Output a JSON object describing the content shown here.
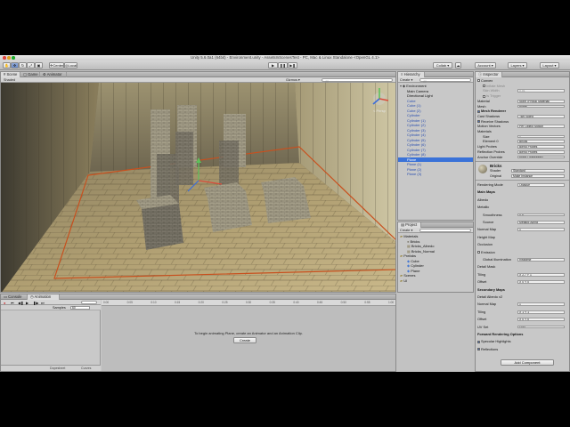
{
  "window": {
    "title": "Unity 5.6.0a1 (64bit) - Environment.unity - AssetsInScenesTest - PC, Mac & Linux Standalone <OpenGL 4.1>"
  },
  "toolbar": {
    "pivot_label": "Center",
    "space_label": "Local",
    "collab_label": "Collab ▾",
    "account_label": "Account ▾",
    "layers_label": "Layers ▾",
    "layout_label": "Layout ▾"
  },
  "scene": {
    "tabs": [
      "Scene",
      "Game",
      "Animator"
    ],
    "shading_mode": "Shaded",
    "gizmos_label": "Gizmos ▾",
    "search_placeholder": "All",
    "persp_label": "< Persp"
  },
  "hierarchy": {
    "tab": "Hierarchy",
    "create_label": "Create ▾",
    "search_placeholder": "All",
    "root": "Environment",
    "items": [
      "Main Camera",
      "Directional Light",
      "Cube",
      "Cube (1)",
      "Cube (2)",
      "Cylinder",
      "Cylinder (1)",
      "Cylinder (2)",
      "Cylinder (3)",
      "Cylinder (4)",
      "Cylinder (5)",
      "Cylinder (6)",
      "Cylinder (7)",
      "Cylinder (8)",
      "Plane",
      "Plane (1)",
      "Plane (2)",
      "Plane (3)"
    ],
    "selected": "Plane"
  },
  "project": {
    "tab": "Project",
    "create_label": "Create ▾",
    "items": [
      {
        "label": "Materials",
        "depth": 0,
        "type": "folder"
      },
      {
        "label": "Bricks",
        "depth": 1,
        "type": "material"
      },
      {
        "label": "Bricks_Albedo",
        "depth": 1,
        "type": "texture"
      },
      {
        "label": "Bricks_Normal",
        "depth": 1,
        "type": "texture"
      },
      {
        "label": "Prefabs",
        "depth": 0,
        "type": "folder"
      },
      {
        "label": "Cube",
        "depth": 1,
        "type": "prefab"
      },
      {
        "label": "Cylinder",
        "depth": 1,
        "type": "prefab"
      },
      {
        "label": "Plane",
        "depth": 1,
        "type": "prefab"
      },
      {
        "label": "Scenes",
        "depth": 0,
        "type": "folder"
      },
      {
        "label": "UI",
        "depth": 0,
        "type": "folder"
      }
    ]
  },
  "animation": {
    "tabs": [
      "Console",
      "Animation"
    ],
    "samples_label": "Samples",
    "samples_value": "60",
    "timeline_ticks": [
      "0:00",
      "0:05",
      "0:10",
      "0:15",
      "0:20",
      "0:25",
      "0:30",
      "0:35",
      "0:40",
      "0:45",
      "0:50",
      "0:55",
      "1:00"
    ],
    "message": "To begin animating Plane, create an Animator and an Animation Clip.",
    "create_button": "Create",
    "bottom_tabs": [
      "Dopesheet",
      "Curves"
    ]
  },
  "inspector": {
    "tab": "Inspector",
    "rows": [
      {
        "label": "Convex",
        "value": "",
        "style": "normal",
        "check": "off"
      },
      {
        "label": "Inflate Mesh",
        "value": "",
        "style": "dim",
        "check": "off"
      },
      {
        "label": "Skin Width",
        "value": "0.01",
        "style": "dim"
      },
      {
        "label": "Is Trigger",
        "value": "",
        "style": "dim",
        "check": "off"
      },
      {
        "label": "Material",
        "value": "None (Physic Material)",
        "style": "normal"
      },
      {
        "label": "Mesh",
        "value": "Plane",
        "style": "normal"
      },
      {
        "label": "Mesh Renderer",
        "value": "",
        "style": "head",
        "check": "on"
      },
      {
        "label": "Cast Shadows",
        "value": "Two Sided",
        "style": "normal"
      },
      {
        "label": "Receive Shadows",
        "value": "",
        "style": "normal",
        "check": "on"
      },
      {
        "label": "Motion Vectors",
        "value": "Per Object Motion",
        "style": "normal"
      },
      {
        "label": "Materials",
        "value": "",
        "style": "normal"
      },
      {
        "label": "Size",
        "value": "1",
        "style": "indent"
      },
      {
        "label": "Element 0",
        "value": "Bricks",
        "style": "indent"
      },
      {
        "label": "Light Probes",
        "value": "Blend Probes",
        "style": "normal"
      },
      {
        "label": "Reflection Probes",
        "value": "Blend Probes",
        "style": "normal"
      },
      {
        "label": "Anchor Override",
        "value": "None (Transform)",
        "style": "normal"
      }
    ],
    "material": {
      "name": "Bricks",
      "shader_label": "Shader",
      "shader_value": "Standard",
      "original_label": "Original",
      "original_value": "Make Instance"
    },
    "rows2": [
      {
        "label": "Rendering Mode",
        "value": "Opaque",
        "style": "normal"
      },
      {
        "label": "Main Maps",
        "value": "",
        "style": "head"
      },
      {
        "label": "Albedo",
        "value": "",
        "style": "normal"
      },
      {
        "label": "Metallic",
        "value": "",
        "style": "normal"
      },
      {
        "label": "Smoothness",
        "value": "0.5",
        "style": "indent"
      },
      {
        "label": "Source",
        "value": "Metallic Alpha",
        "style": "indent"
      },
      {
        "label": "Normal Map",
        "value": "1",
        "style": "normal"
      },
      {
        "label": "Height Map",
        "value": "",
        "style": "normal"
      },
      {
        "label": "Occlusion",
        "value": "",
        "style": "normal"
      },
      {
        "label": "Emission",
        "value": "",
        "style": "normal",
        "check": "off"
      },
      {
        "label": "Global Illumination",
        "value": "Realtime",
        "style": "indent"
      },
      {
        "label": "Detail Mask",
        "value": "",
        "style": "normal"
      },
      {
        "label": "Tiling",
        "value": "X 2.7   Y 1",
        "style": "normal"
      },
      {
        "label": "Offset",
        "value": "X 0   Y 0",
        "style": "normal"
      },
      {
        "label": "Secondary Maps",
        "value": "",
        "style": "head"
      },
      {
        "label": "Detail Albedo x2",
        "value": "",
        "style": "normal"
      },
      {
        "label": "Normal Map",
        "value": "1",
        "style": "normal"
      },
      {
        "label": "Tiling",
        "value": "X 1   Y 1",
        "style": "normal"
      },
      {
        "label": "Offset",
        "value": "X 0   Y 0",
        "style": "normal"
      },
      {
        "label": "UV Set",
        "value": "UV0",
        "style": "normal"
      },
      {
        "label": "Forward Rendering Options",
        "value": "",
        "style": "head"
      },
      {
        "label": "Specular Highlights",
        "value": "",
        "style": "normal",
        "check": "on"
      },
      {
        "label": "Reflections",
        "value": "",
        "style": "normal",
        "check": "on"
      }
    ],
    "add_component": "Add Component"
  },
  "colors": {
    "selection": "#3a72d8",
    "panel": "#c8c8c8",
    "floor_outline": "#c8501e"
  }
}
